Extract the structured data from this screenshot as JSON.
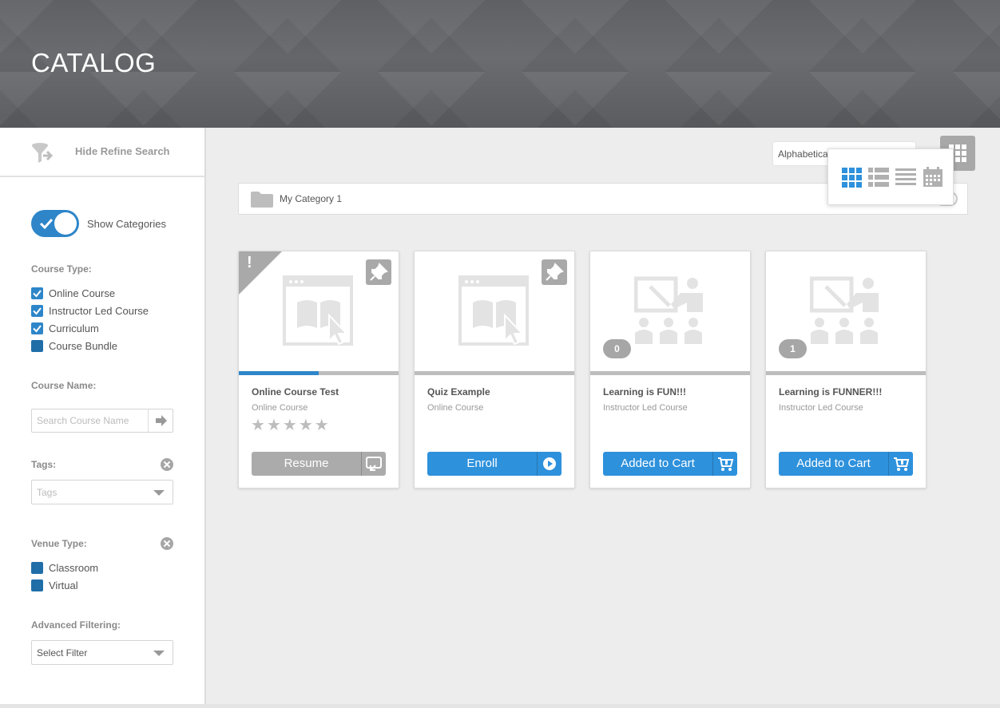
{
  "header": {
    "title": "CATALOG"
  },
  "sidebar": {
    "refine_label": "Hide Refine Search",
    "show_categories_label": "Show Categories",
    "course_type": {
      "label": "Course Type:",
      "items": [
        {
          "label": "Online Course",
          "checked": true
        },
        {
          "label": "Instructor Led Course",
          "checked": true
        },
        {
          "label": "Curriculum",
          "checked": true
        },
        {
          "label": "Course Bundle",
          "checked": false
        }
      ]
    },
    "course_name": {
      "label": "Course Name:",
      "placeholder": "Search Course Name"
    },
    "tags": {
      "label": "Tags:",
      "placeholder": "Tags"
    },
    "venue_type": {
      "label": "Venue Type:",
      "items": [
        {
          "label": "Classroom",
          "checked": false
        },
        {
          "label": "Virtual",
          "checked": false
        }
      ]
    },
    "advanced": {
      "label": "Advanced Filtering:",
      "value": "Select Filter"
    }
  },
  "main": {
    "sort_value": "Alphabetical",
    "category_name": "My Category 1",
    "cards": [
      {
        "title": "Online Course Test",
        "type": "Online Course",
        "action": "Resume",
        "rating": 0,
        "progress": 0.5
      },
      {
        "title": "Quiz Example",
        "type": "Online Course",
        "action": "Enroll",
        "progress": 0
      },
      {
        "title": "Learning is FUN!!!",
        "type": "Instructor Led Course",
        "action": "Added to Cart",
        "count": "0",
        "progress": 0
      },
      {
        "title": "Learning is FUNNER!!!",
        "type": "Instructor Led Course",
        "action": "Added to Cart",
        "count": "1",
        "progress": 0
      }
    ]
  },
  "colors": {
    "accent": "#2e91dc",
    "gray_button": "#ababab",
    "header": "#616367"
  }
}
